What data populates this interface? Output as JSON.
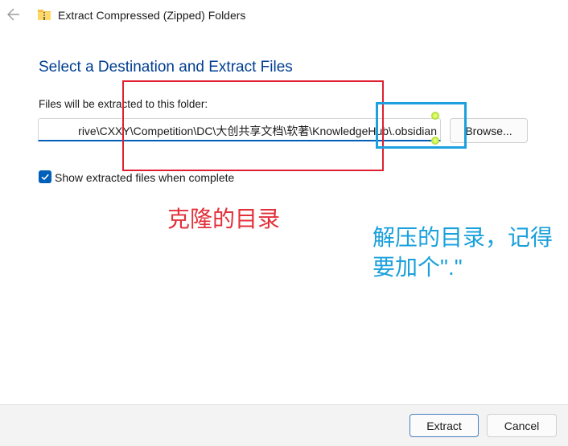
{
  "window": {
    "title": "Extract Compressed (Zipped) Folders"
  },
  "dialog": {
    "heading": "Select a Destination and Extract Files",
    "field_label": "Files will be extracted to this folder:",
    "path_value": "rive\\CXXY\\Competition\\DC\\大创共享文档\\软著\\KnowledgeHub\\.obsidian",
    "browse_label": "Browse...",
    "checkbox_label": "Show extracted files when complete",
    "checkbox_checked": true
  },
  "annotations": {
    "red_note": "克隆的目录",
    "blue_note_line1": "解压的目录，记得",
    "blue_note_line2": "要加个\".\""
  },
  "footer": {
    "extract_label": "Extract",
    "cancel_label": "Cancel"
  },
  "colors": {
    "accent": "#005fb8",
    "heading": "#003e92",
    "annotation_red": "#e02030",
    "annotation_blue": "#1ea0e0"
  },
  "icons": {
    "back": "arrow-left-icon",
    "folder": "zip-folder-icon",
    "check": "checkmark-icon"
  }
}
